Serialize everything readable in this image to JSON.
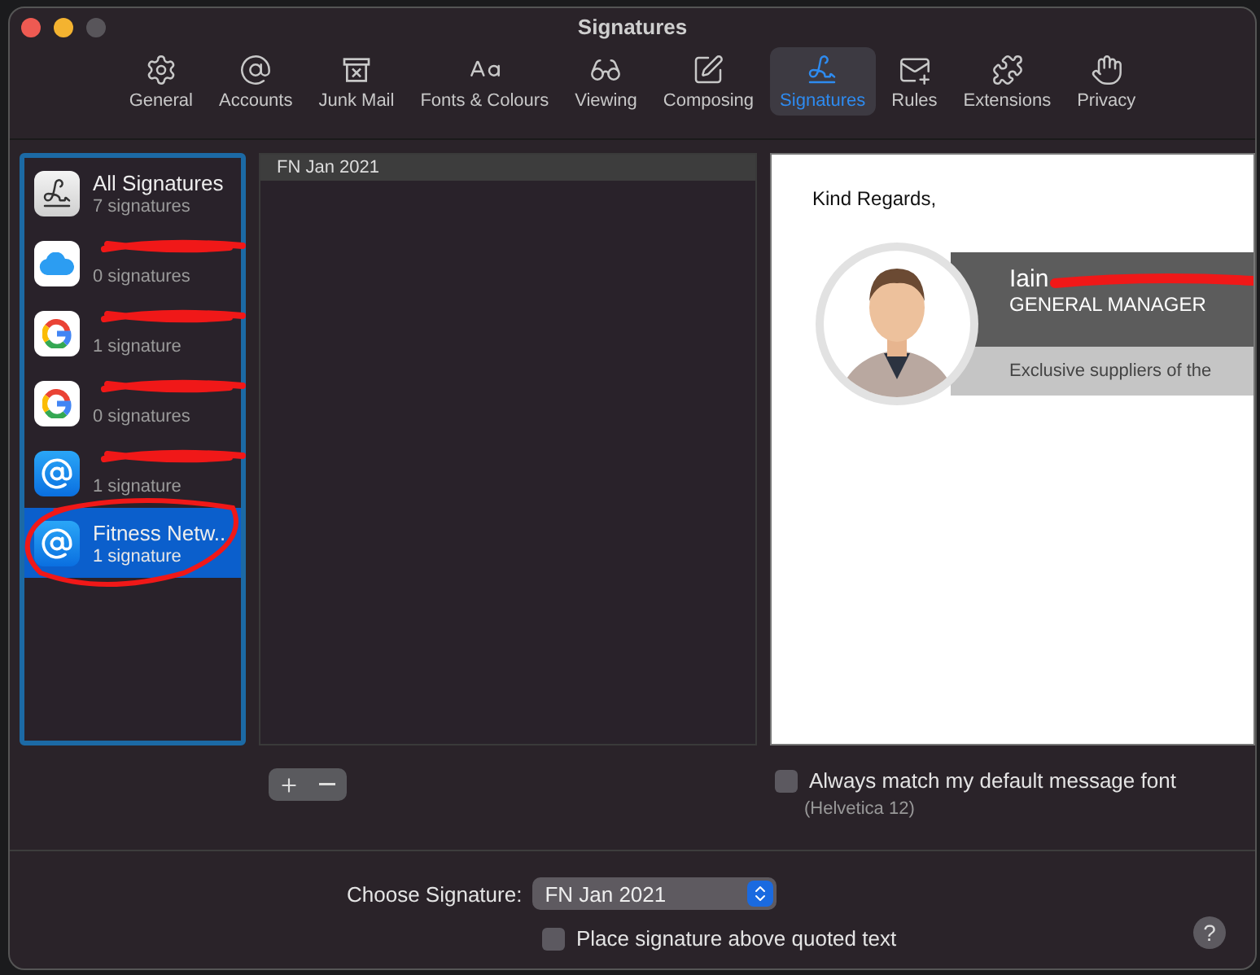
{
  "window": {
    "title": "Signatures"
  },
  "toolbar": [
    {
      "label": "General",
      "kind": "gear",
      "selected": false
    },
    {
      "label": "Accounts",
      "kind": "at",
      "selected": false
    },
    {
      "label": "Junk Mail",
      "kind": "junk",
      "selected": false
    },
    {
      "label": "Fonts & Colours",
      "kind": "fonts",
      "selected": false
    },
    {
      "label": "Viewing",
      "kind": "glasses",
      "selected": false
    },
    {
      "label": "Composing",
      "kind": "compose",
      "selected": false
    },
    {
      "label": "Signatures",
      "kind": "signature",
      "selected": true
    },
    {
      "label": "Rules",
      "kind": "rules",
      "selected": false
    },
    {
      "label": "Extensions",
      "kind": "puzzle",
      "selected": false
    },
    {
      "label": "Privacy",
      "kind": "hand",
      "selected": false
    }
  ],
  "accounts": [
    {
      "kind": "all",
      "name": "All Signatures",
      "count": "7 signatures",
      "redacted": false,
      "circled": false,
      "selected": false
    },
    {
      "kind": "icloud",
      "count": "0 signatures",
      "redacted": true,
      "circled": false,
      "selected": false
    },
    {
      "kind": "google",
      "count": "1 signature",
      "redacted": true,
      "circled": false,
      "selected": false
    },
    {
      "kind": "google",
      "count": "0 signatures",
      "redacted": true,
      "circled": false,
      "selected": false
    },
    {
      "kind": "mail",
      "count": "1 signature",
      "redacted": true,
      "circled": false,
      "selected": false
    },
    {
      "kind": "mail",
      "name": "Fitness Netw..",
      "count": "1 signature",
      "redacted": false,
      "circled": true,
      "selected": true
    }
  ],
  "signatures": [
    {
      "name": "FN Jan 2021",
      "selected": true
    }
  ],
  "preview": {
    "greeting": "Kind Regards,",
    "name": "Iain",
    "surname_redacted": true,
    "job_title": "GENERAL MANAGER",
    "tagline": "Exclusive suppliers of the"
  },
  "font_match": {
    "label": "Always match my default message font",
    "checked": false,
    "hint": "(Helvetica 12)"
  },
  "choose_signature": {
    "label": "Choose Signature:",
    "value": "FN Jan 2021"
  },
  "place_above": {
    "label": "Place signature above quoted text",
    "checked": false
  },
  "help": "?"
}
